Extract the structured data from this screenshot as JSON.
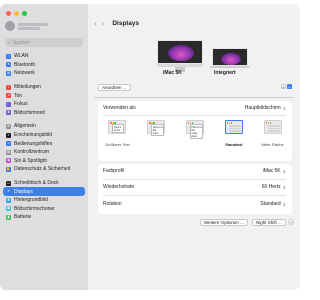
{
  "sidebar": {
    "search_placeholder": "Suchen",
    "groups": [
      [
        {
          "label": "WLAN",
          "color": "#3478f6",
          "icon": "wifi-icon",
          "glyph": "≈"
        },
        {
          "label": "Bluetooth",
          "color": "#3478f6",
          "icon": "bluetooth-icon",
          "glyph": "ʙ"
        },
        {
          "label": "Netzwerk",
          "color": "#3478f6",
          "icon": "globe-icon",
          "glyph": "◍"
        }
      ],
      [
        {
          "label": "Mitteilungen",
          "color": "#f5453d",
          "icon": "bell-icon",
          "glyph": "•"
        },
        {
          "label": "Ton",
          "color": "#f5453d",
          "icon": "speaker-icon",
          "glyph": "◂"
        },
        {
          "label": "Fokus",
          "color": "#6a5be0",
          "icon": "moon-icon",
          "glyph": "☾"
        },
        {
          "label": "Bildschirmzeit",
          "color": "#6a5be0",
          "icon": "hourglass-icon",
          "glyph": "⧗"
        }
      ],
      [
        {
          "label": "Allgemein",
          "color": "#8e8e93",
          "icon": "gear-icon",
          "glyph": "⚙"
        },
        {
          "label": "Erscheinungsbild",
          "color": "#1d1d1f",
          "icon": "appearance-icon",
          "glyph": "◐"
        },
        {
          "label": "Bedienungshilfen",
          "color": "#3478f6",
          "icon": "accessibility-icon",
          "glyph": "☺"
        },
        {
          "label": "Kontrollzentrum",
          "color": "#8e8e93",
          "icon": "control-center-icon",
          "glyph": "▤"
        },
        {
          "label": "Siri & Spotlight",
          "color": "#c04ad8",
          "icon": "siri-icon",
          "glyph": "◉"
        },
        {
          "label": "Datenschutz & Sicherheit",
          "color": "#3478f6",
          "icon": "hand-icon",
          "glyph": "✋"
        }
      ],
      [
        {
          "label": "Schreibtisch & Dock",
          "color": "#1d1d1f",
          "icon": "dock-icon",
          "glyph": "▭"
        },
        {
          "label": "Displays",
          "color": "#3478f6",
          "icon": "sun-icon",
          "glyph": "☀",
          "active": true
        },
        {
          "label": "Hintergrundbild",
          "color": "#30a7e8",
          "icon": "wallpaper-icon",
          "glyph": "❀"
        },
        {
          "label": "Bildschirmschoner",
          "color": "#30c0d8",
          "icon": "screensaver-icon",
          "glyph": "▣"
        },
        {
          "label": "Batterie",
          "color": "#34c759",
          "icon": "battery-icon",
          "glyph": "▮"
        }
      ]
    ]
  },
  "header": {
    "back": "‹",
    "forward": "›",
    "title": "Displays"
  },
  "displays": {
    "arrange_label": "Anordnen ...",
    "imac_label": "iMac 5K",
    "builtin_label": "Integriert",
    "add_label": "+",
    "add_menu": "⌄"
  },
  "use_as": {
    "label": "Verwenden als",
    "value": "Hauptbildschirm"
  },
  "resolutions": [
    {
      "label": "Größerer Text",
      "sample": "Here's to the",
      "bold": false,
      "selected": false
    },
    {
      "label": "",
      "sample": "Here's to the crazy",
      "bold": false,
      "selected": false
    },
    {
      "label": "",
      "sample": "Here's to the crazy ones",
      "bold": false,
      "selected": false
    },
    {
      "label": "Standard",
      "sample": "",
      "bold": true,
      "selected": true
    },
    {
      "label": "Mehr Fläche",
      "sample": "",
      "bold": false,
      "selected": false
    }
  ],
  "settings": {
    "color_profile": {
      "label": "Farbprofil",
      "value": "iMac 5K"
    },
    "refresh_rate": {
      "label": "Wiederholrate",
      "value": "60 Hertz"
    },
    "rotation": {
      "label": "Rotation",
      "value": "Standard"
    }
  },
  "footer": {
    "advanced": "Weitere Optionen ...",
    "night_shift": "Night Shift ...",
    "help": "?"
  },
  "colors": {
    "accent": "#3f7fe8",
    "close": "#ff5f57",
    "minimize": "#febc2e",
    "zoom": "#28c840"
  }
}
